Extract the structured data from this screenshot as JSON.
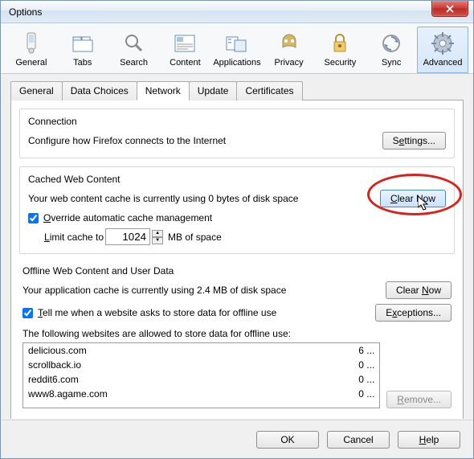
{
  "window_title": "Options",
  "toolbar": [
    {
      "label": "General"
    },
    {
      "label": "Tabs"
    },
    {
      "label": "Search"
    },
    {
      "label": "Content"
    },
    {
      "label": "Applications"
    },
    {
      "label": "Privacy"
    },
    {
      "label": "Security"
    },
    {
      "label": "Sync"
    },
    {
      "label": "Advanced"
    }
  ],
  "subtabs": [
    {
      "label": "General"
    },
    {
      "label": "Data Choices"
    },
    {
      "label": "Network"
    },
    {
      "label": "Update"
    },
    {
      "label": "Certificates"
    }
  ],
  "connection": {
    "legend": "Connection",
    "desc": "Configure how Firefox connects to the Internet",
    "button": "Settings..."
  },
  "cached": {
    "legend": "Cached Web Content",
    "desc": "Your web content cache is currently using 0 bytes of disk space",
    "clear": "Clear Now",
    "override": "Override automatic cache management",
    "limit_label_pre": "Limit cache to",
    "limit_value": "1024",
    "limit_label_post": "MB of space"
  },
  "offline": {
    "legend": "Offline Web Content and User Data",
    "desc": "Your application cache is currently using 2.4 MB of disk space",
    "clear": "Clear Now",
    "tellme": "Tell me when a website asks to store data for offline use",
    "exceptions": "Exceptions...",
    "allowed_text": "The following websites are allowed to store data for offline use:",
    "sites": [
      {
        "name": "delicious.com",
        "size": "6 ..."
      },
      {
        "name": "scrollback.io",
        "size": "0 ..."
      },
      {
        "name": "reddit6.com",
        "size": "0 ..."
      },
      {
        "name": "www8.agame.com",
        "size": "0 ..."
      }
    ],
    "remove": "Remove..."
  },
  "footer": {
    "ok": "OK",
    "cancel": "Cancel",
    "help": "Help"
  }
}
